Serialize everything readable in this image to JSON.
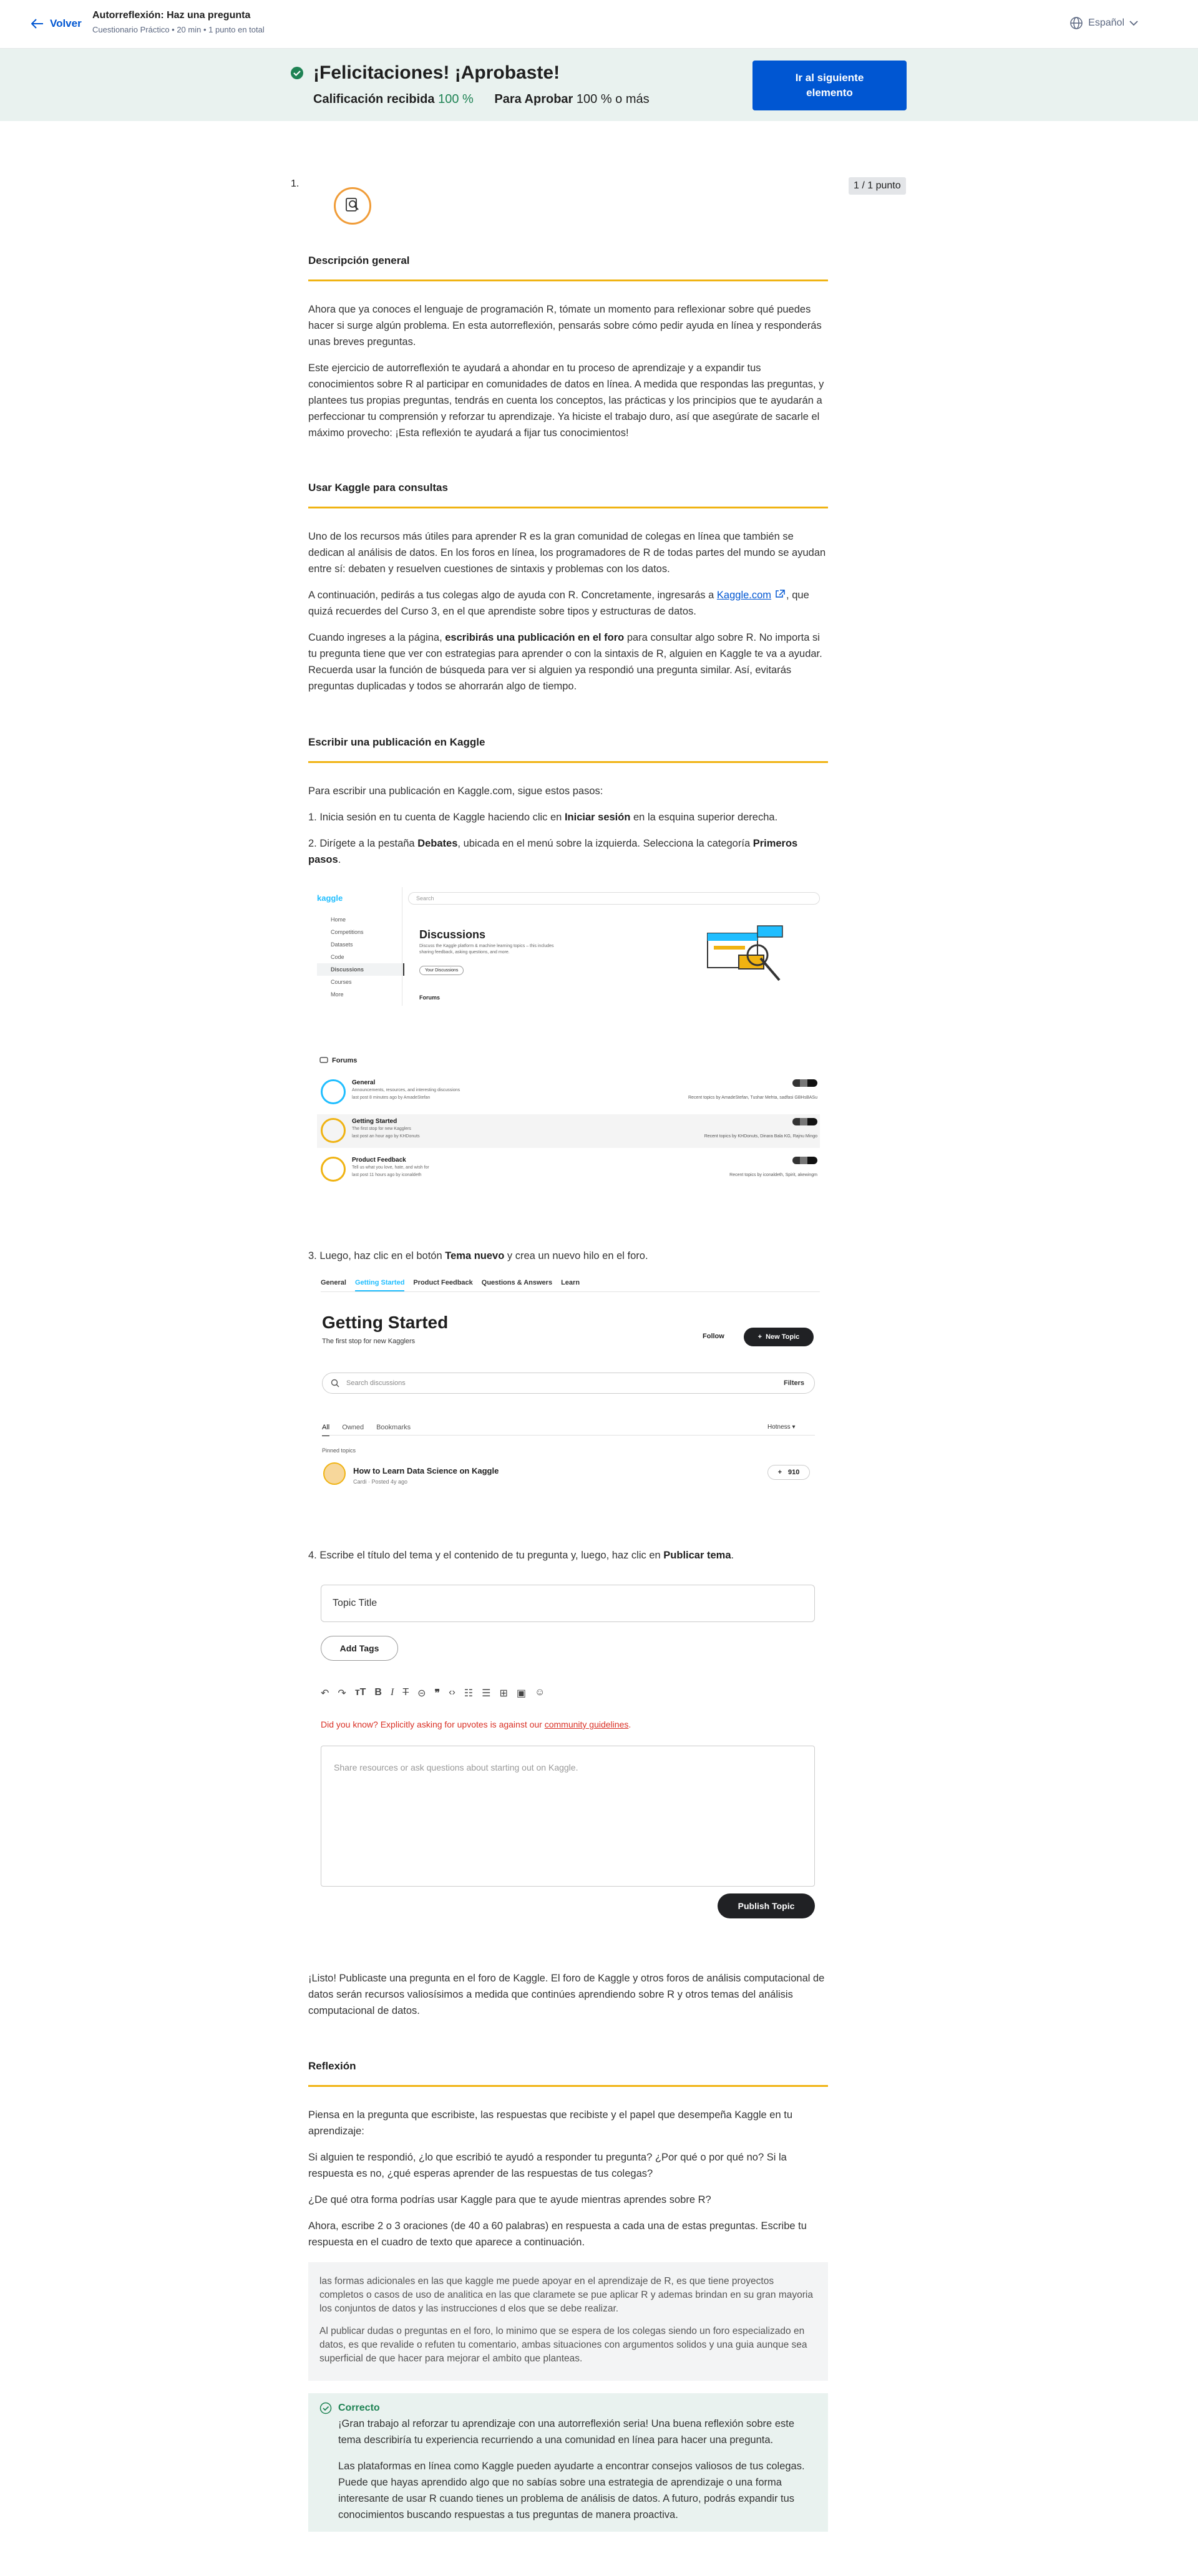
{
  "header": {
    "back_label": "Volver",
    "title": "Autorreflexión: Haz una pregunta",
    "subtitle": "Cuestionario Práctico • 20 min • 1 punto en total",
    "language": "Español"
  },
  "banner": {
    "congrats": "¡Felicitaciones! ¡Aprobaste!",
    "grade_label": "Calificación recibida",
    "grade_value": "100 %",
    "pass_label": "Para Aprobar",
    "pass_value": "100 % o más",
    "next_button": "Ir al siguiente elemento"
  },
  "question": {
    "number": "1.",
    "points": "1 / 1 punto"
  },
  "sections": {
    "overview": {
      "heading": "Descripción general",
      "p1": "Ahora que ya conoces el lenguaje de programación R, tómate un momento para reflexionar sobre qué puedes hacer si surge algún problema. En esta autorreflexión, pensarás sobre cómo pedir ayuda en línea y responderás unas breves preguntas.",
      "p2": "Este ejercicio de autorreflexión te ayudará a ahondar en tu proceso de aprendizaje y a expandir tus conocimientos sobre R al participar en comunidades de datos en línea. A medida que respondas las preguntas, y plantees tus propias preguntas, tendrás en cuenta los conceptos, las prácticas y los principios que te ayudarán a perfeccionar tu comprensión y reforzar tu aprendizaje. Ya hiciste el trabajo duro, así que asegúrate de sacarle el máximo provecho: ¡Esta reflexión te ayudará a fijar tus conocimientos!"
    },
    "kaggle": {
      "heading": "Usar Kaggle para consultas",
      "p1": "Uno de los recursos más útiles para aprender R es la gran comunidad de colegas en línea que también se dedican al análisis de datos. En los foros en línea, los programadores de R de todas partes del mundo se ayudan entre sí: debaten y resuelven cuestiones de sintaxis y problemas con los datos.",
      "p2_a": "A continuación, pedirás a tus colegas algo de ayuda con R. Concretamente, ingresarás a ",
      "p2_link": "Kaggle.com",
      "p2_b": ", que quizá recuerdes del Curso 3, en el que aprendiste sobre tipos y estructuras de datos.",
      "p3_a": "Cuando ingreses a la página, ",
      "p3_bold": "escribirás una publicación en el foro",
      "p3_b": " para consultar algo sobre R. No importa si tu pregunta tiene que ver con estrategias para aprender o con la sintaxis de R, alguien en Kaggle te va a ayudar. Recuerda usar la función de búsqueda para ver si alguien ya respondió una pregunta similar. Así, evitarás preguntas duplicadas y todos se ahorrarán algo de tiempo."
    },
    "post": {
      "heading": "Escribir una publicación en Kaggle",
      "intro": "Para escribir una publicación en Kaggle.com, sigue estos pasos:",
      "s1_a": "1. Inicia sesión en tu cuenta de Kaggle haciendo clic en ",
      "s1_bold": "Iniciar sesión",
      "s1_b": " en la esquina superior derecha.",
      "s2_a": "2. Dirígete a la pestaña ",
      "s2_bold1": "Debates",
      "s2_b": ", ubicada en el menú sobre la izquierda. Selecciona la categoría ",
      "s2_bold2": "Primeros pasos",
      "s2_c": ".",
      "s3_a": "3. Luego, haz clic en el botón ",
      "s3_bold": "Tema nuevo",
      "s3_b": " y crea un nuevo hilo en el foro.",
      "s4_a": "4. Escribe el título del tema y el contenido de tu pregunta y, luego, haz clic en ",
      "s4_bold": "Publicar tema",
      "s4_b": ".",
      "done": "¡Listo! Publicaste una pregunta en el foro de Kaggle. El foro de Kaggle y otros foros de análisis computacional de datos serán recursos valiosísimos a medida que continúes aprendiendo sobre R y otros temas del análisis computacional de datos."
    },
    "reflection": {
      "heading": "Reflexión",
      "p1": "Piensa en la pregunta que escribiste, las respuestas que recibiste y el papel que desempeña Kaggle en tu aprendizaje:",
      "p2": "Si alguien te respondió, ¿lo que escribió te ayudó a responder tu pregunta? ¿Por qué o por qué no? Si la respuesta es no, ¿qué esperas aprender de las respuestas de tus colegas?",
      "p3": "¿De qué otra forma podrías usar Kaggle para que te ayude mientras aprendes sobre R?",
      "p4": "Ahora, escribe 2 o 3 oraciones (de 40 a 60 palabras) en respuesta a cada una de estas preguntas. Escribe tu respuesta en el cuadro de texto que aparece a continuación."
    }
  },
  "answer": {
    "p1": "las formas adicionales en las que kaggle me puede apoyar en el aprendizaje de R, es que tiene proyectos completos o casos de uso de analitica en las que claramete se pue aplicar R y ademas brindan en su gran mayoria los conjuntos de datos y las instrucciones d elos que se debe realizar.",
    "p2": "Al publicar dudas o preguntas en el foro, lo minimo que se espera de los colegas siendo un foro especializado en datos, es que revalide o refuten tu comentario, ambas situaciones con argumentos solidos y una guia aunque sea superficial de que hacer para mejorar el ambito que planteas."
  },
  "feedback": {
    "title": "Correcto",
    "p1": "¡Gran trabajo al reforzar tu aprendizaje con una autorreflexión seria! Una buena reflexión sobre este tema describiría tu experiencia recurriendo a una comunidad en línea para hacer una pregunta.",
    "p2": "Las plataformas en línea como Kaggle pueden ayudarte a encontrar consejos valiosos de tus colegas. Puede que hayas aprendido algo que no sabías sobre una estrategia de aprendizaje o una forma interesante de usar R cuando tienes un problema de análisis de datos. A futuro, podrás expandir tus conocimientos buscando respuestas a tus preguntas de manera proactiva."
  },
  "kaggle_disc": {
    "logo": "kaggle",
    "search": "Search",
    "nav": [
      "Home",
      "Competitions",
      "Datasets",
      "Code",
      "Discussions",
      "Courses",
      "More"
    ],
    "title": "Discussions",
    "desc1": "Discuss the Kaggle platform & machine learning topics – this includes",
    "desc2": "sharing feedback, asking questions, and more.",
    "new_btn": "Your Discussions",
    "forums": "Forums"
  },
  "kaggle_forums": {
    "heading": "Forums",
    "rows": [
      {
        "title": "General",
        "desc": "Announcements, resources, and interesting discussions",
        "meta": "last post 8 minutes ago by AmadeStefan",
        "recent": "Recent topics by AmadeStefan, Tushar Mehta, sadfasi GBHsBASu"
      },
      {
        "title": "Getting Started",
        "desc": "The first stop for new Kagglers",
        "meta": "last post an hour ago by KHDonuts",
        "recent": "Recent topics by KHDonuts, Dinara Bala KG, Rajnu Mingo"
      },
      {
        "title": "Product Feedback",
        "desc": "Tell us what you love, hate, and wish for",
        "meta": "last post 11 hours ago by iconaldeth",
        "recent": "Recent topics by iconaldeth, Spirit, akewingm"
      }
    ]
  },
  "kaggle_gs": {
    "tabs": [
      "General",
      "Getting Started",
      "Product Feedback",
      "Questions & Answers",
      "Learn"
    ],
    "title": "Getting Started",
    "subtitle": "The first stop for new Kagglers",
    "follow": "Follow",
    "new_topic": "New Topic",
    "search_ph": "Search discussions",
    "filters": "Filters",
    "subtabs": [
      "All",
      "Owned",
      "Bookmarks"
    ],
    "sort": "Hotness",
    "pinned": "Pinned topics",
    "topic_title": "How to Learn Data Science on Kaggle",
    "topic_meta": "Cardi · Posted 4y ago",
    "votes": "910"
  },
  "kaggle_post": {
    "topic_ph": "Topic Title",
    "add_tags": "Add Tags",
    "warn_a": "Did you know? Explicitly asking for upvotes is against our ",
    "warn_link": "community guidelines",
    "warn_b": ".",
    "body_ph": "Share resources or ask questions about starting out on Kaggle.",
    "publish": "Publish Topic"
  }
}
